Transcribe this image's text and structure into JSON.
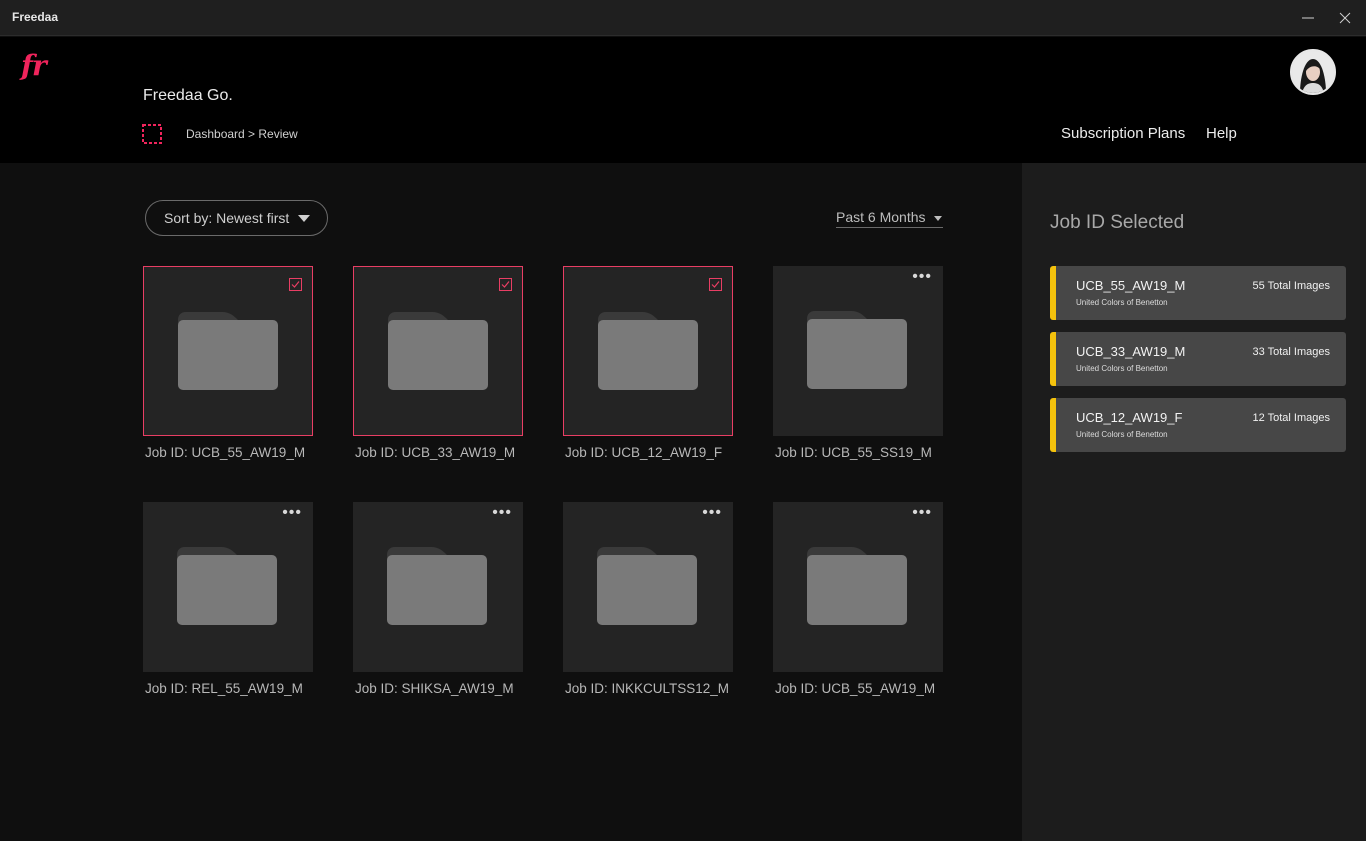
{
  "window": {
    "title": "Freedaa"
  },
  "header": {
    "logo_text": "fr",
    "brand_title": "Freedaa Go.",
    "breadcrumb": "Dashboard > Review",
    "nav": {
      "plans": "Subscription Plans",
      "help": "Help"
    }
  },
  "controls": {
    "sort_label": "Sort by: Newest first",
    "period_label": "Past 6 Months"
  },
  "jobs": [
    {
      "label": "Job ID: UCB_55_AW19_M",
      "selected": true
    },
    {
      "label": "Job ID: UCB_33_AW19_M",
      "selected": true
    },
    {
      "label": "Job ID: UCB_12_AW19_F",
      "selected": true
    },
    {
      "label": "Job ID: UCB_55_SS19_M",
      "selected": false
    },
    {
      "label": "Job ID: REL_55_AW19_M",
      "selected": false
    },
    {
      "label": "Job ID: SHIKSA_AW19_M",
      "selected": false
    },
    {
      "label": "Job ID: INKKCULTSS12_M",
      "selected": false
    },
    {
      "label": "Job ID: UCB_55_AW19_M",
      "selected": false
    }
  ],
  "panel": {
    "title": "Job ID Selected",
    "selected": [
      {
        "id": "UCB_55_AW19_M",
        "brand": "United Colors of Benetton",
        "count": "55 Total Images"
      },
      {
        "id": "UCB_33_AW19_M",
        "brand": "United Colors of Benetton",
        "count": "33 Total Images"
      },
      {
        "id": "UCB_12_AW19_F",
        "brand": "United Colors of Benetton",
        "count": "12 Total Images"
      }
    ]
  },
  "colors": {
    "accent": "#f0245c",
    "highlight": "#f4c20d"
  },
  "icons": {
    "more": "•••"
  }
}
